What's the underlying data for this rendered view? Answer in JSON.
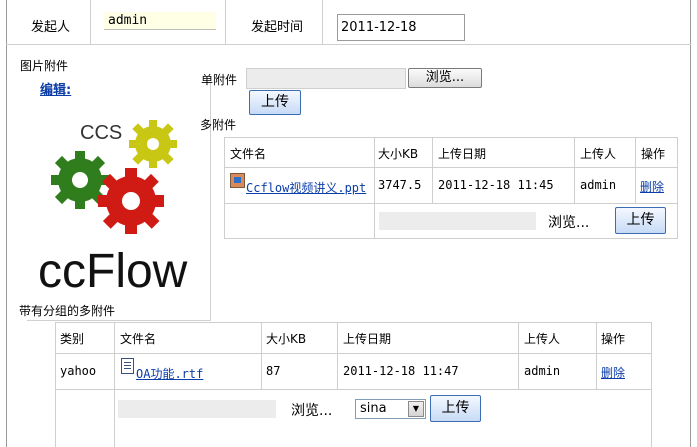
{
  "header": {
    "initiator_label": "发起人",
    "initiator_value": "admin",
    "start_time_label": "发起时间",
    "start_time_value": "2011-12-18"
  },
  "image_attachment": {
    "label": "图片附件",
    "edit_link": "编辑:",
    "logo_text_top": "CCS",
    "logo_text_main": "ccFlow"
  },
  "single_attachment": {
    "label": "单附件",
    "browse_button": "浏览...",
    "upload_button": "上传"
  },
  "multi_attachment": {
    "label": "多附件",
    "columns": [
      "文件名",
      "大小KB",
      "上传日期",
      "上传人",
      "操作"
    ],
    "rows": [
      {
        "file_name": "Ccflow视频讲义.ppt",
        "size": "3747.5",
        "date": "2011-12-18 11:45",
        "uploader": "admin",
        "action": "删除"
      }
    ],
    "browse_button": "浏览...",
    "upload_button": "上传"
  },
  "grouped_attachment": {
    "label": "带有分组的多附件",
    "columns": [
      "类别",
      "文件名",
      "大小KB",
      "上传日期",
      "上传人",
      "操作"
    ],
    "rows": [
      {
        "category": "yahoo",
        "file_name": "OA功能.rtf",
        "size": "87",
        "date": "2011-12-18 11:47",
        "uploader": "admin",
        "action": "删除"
      }
    ],
    "browse_button": "浏览...",
    "category_select": "sina",
    "upload_button": "上传"
  }
}
